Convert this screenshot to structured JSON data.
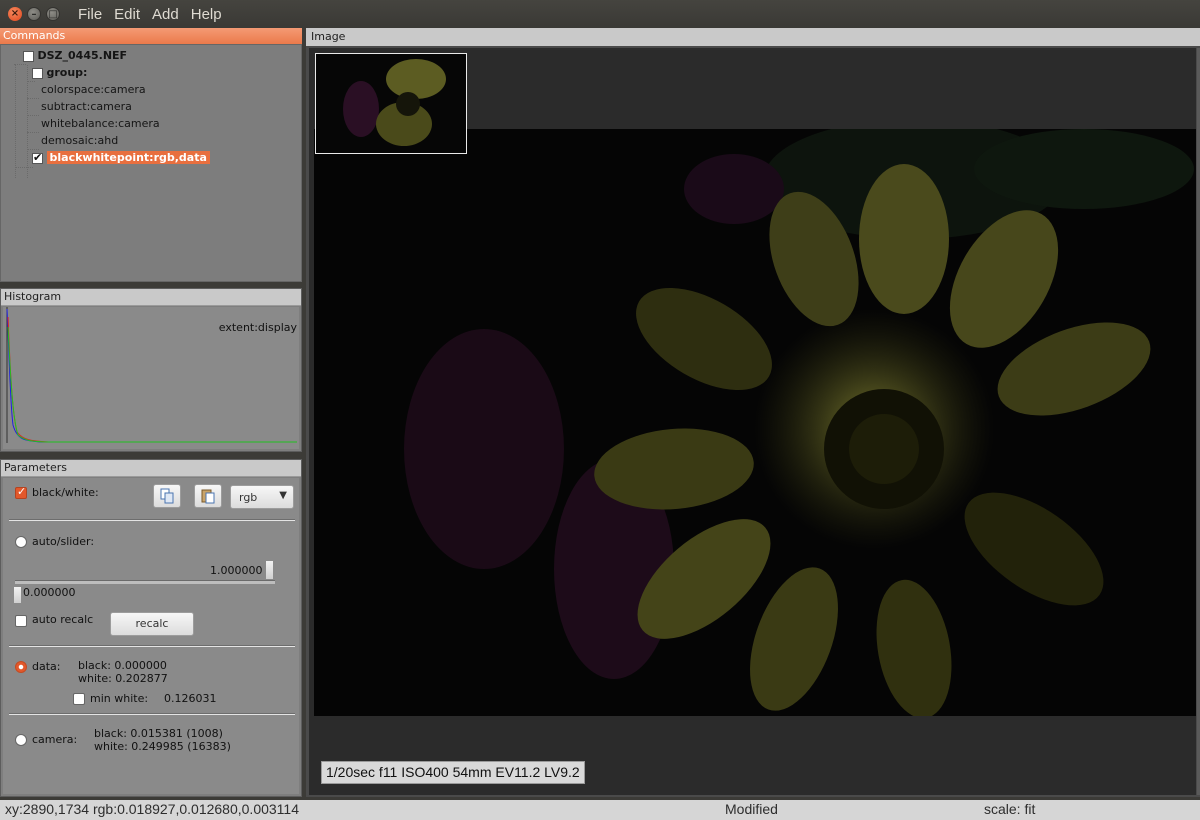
{
  "window": {
    "close_glyph": "×",
    "min_glyph": "–",
    "max_glyph": "□"
  },
  "menu": [
    "File",
    "Edit",
    "Add",
    "Help"
  ],
  "commands": {
    "title": "Commands",
    "root": "DSZ_0445.NEF",
    "group": "group:",
    "items": [
      "colorspace:camera",
      "subtract:camera",
      "whitebalance:camera",
      "demosaic:ahd"
    ],
    "selected": "blackwhitepoint:rgb,data"
  },
  "histogram": {
    "title": "Histogram",
    "extent_label": "extent:display",
    "colors": {
      "red": "#e02020",
      "green": "#20c020",
      "blue": "#2020e0"
    }
  },
  "parameters": {
    "title": "Parameters",
    "bw_label": "black/white:",
    "bw_checked": true,
    "copy_icon": "copy-icon",
    "paste_icon": "paste-icon",
    "channel_select": "rgb",
    "auto_slider_label": "auto/slider:",
    "slider_top_value": "1.000000",
    "slider_bottom_value": "0.000000",
    "auto_recalc_label": "auto recalc",
    "recalc_button": "recalc",
    "data_label": "data:",
    "data_black": "black: 0.000000",
    "data_white": "white: 0.202877",
    "min_white_label": "min white:",
    "min_white_value": "0.126031",
    "camera_label": "camera:",
    "camera_black": "black: 0.015381 (1008)",
    "camera_white": "white: 0.249985 (16383)"
  },
  "image": {
    "title": "Image",
    "exif": "1/20sec  f11  ISO400  54mm  EV11.2 LV9.2"
  },
  "status": {
    "coords": "xy:2890,1734 rgb:0.018927,0.012680,0.003114",
    "state": "Modified",
    "scale": "scale: fit"
  },
  "colors": {
    "accent": "#eb7a4b",
    "panel_bg": "#7e7e7e",
    "selected_bg": "#e86f3f"
  }
}
